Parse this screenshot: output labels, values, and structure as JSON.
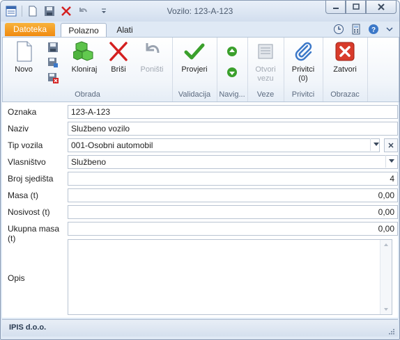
{
  "window": {
    "title": "Vozilo: 123-A-123"
  },
  "tabs": {
    "file": "Datoteka",
    "home": "Polazno",
    "tools": "Alati"
  },
  "ribbon": {
    "obrada": {
      "label": "Obrada",
      "new": "Novo",
      "clone": "Kloniraj",
      "delete": "Briši",
      "undo": "Poništi"
    },
    "validacija": {
      "label": "Validacija",
      "check": "Provjeri"
    },
    "navig": {
      "label": "Navig..."
    },
    "veze": {
      "label": "Veze",
      "open_line1": "Otvori",
      "open_line2": "vezu"
    },
    "privitci": {
      "label": "Privitci",
      "attachments": "Privitci",
      "count": "(0)"
    },
    "obrazac": {
      "label": "Obrazac",
      "close": "Zatvori"
    }
  },
  "form": {
    "oznaka": {
      "label": "Oznaka",
      "value": "123-A-123"
    },
    "naziv": {
      "label": "Naziv",
      "value": "Službeno vozilo"
    },
    "tip": {
      "label": "Tip vozila",
      "value": "001-Osobni automobil"
    },
    "vlasnistvo": {
      "label": "Vlasništvo",
      "value": "Službeno"
    },
    "sjedista": {
      "label": "Broj sjedišta",
      "value": "4"
    },
    "masa": {
      "label": "Masa (t)",
      "value": "0,00"
    },
    "nosivost": {
      "label": "Nosivost (t)",
      "value": "0,00"
    },
    "ukupna": {
      "label": "Ukupna masa (t)",
      "value": "0,00"
    },
    "opis": {
      "label": "Opis",
      "value": ""
    }
  },
  "status": {
    "company": "IPIS d.o.o."
  },
  "colors": {
    "accent_orange": "#f08a10",
    "check_green": "#3aa02c",
    "delete_red": "#d42020",
    "close_red": "#d83b2b"
  }
}
